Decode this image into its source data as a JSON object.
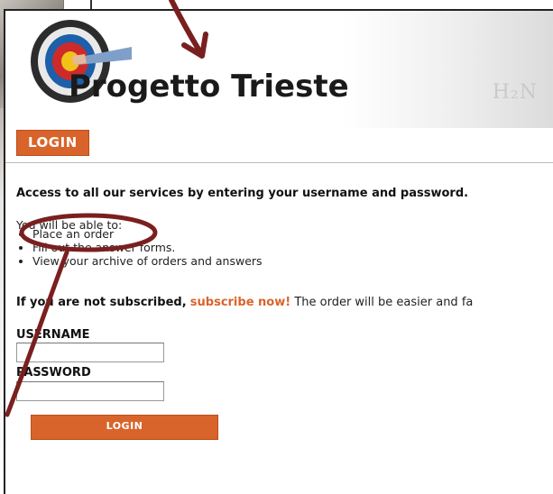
{
  "header": {
    "brand_name": "Progetto Trieste",
    "chem_text": "H₂N"
  },
  "login_tab": {
    "label": "LOGIN"
  },
  "intro": {
    "access_text": "Access to all our services by entering your username and password.",
    "able_to_text": "You will be able to:",
    "benefits": [
      "Place an order",
      "Fill out the answer forms.",
      "View your archive of orders and answers"
    ]
  },
  "subscribe": {
    "not_subscribed_text": "If you are not subscribed,",
    "subscribe_link": "subscribe now!",
    "rest_text": "The order will be easier and fa"
  },
  "form": {
    "username_label": "USERNAME",
    "username_value": "",
    "password_label": "PASSWORD",
    "password_value": "",
    "login_button_label": "LOGIN"
  },
  "colors": {
    "accent": "#d9642b",
    "annotation": "#7a1f1f"
  },
  "icons": {
    "logo": "target-logo-icon"
  }
}
